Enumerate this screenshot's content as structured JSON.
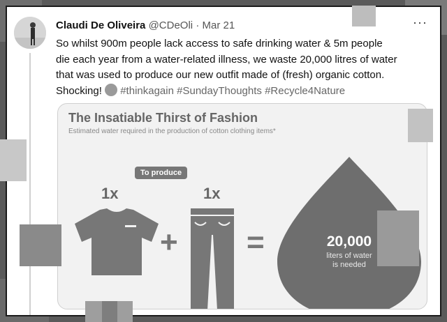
{
  "tweet": {
    "author_name": "Claudi De Oliveira",
    "author_handle": "@CDeOli",
    "separator": "·",
    "date": "Mar 21",
    "more_label": "···",
    "text_line1": "So whilst 900m people lack access to safe drinking water & 5m people",
    "text_line2": "die each year from a water-related illness, we waste 20,000 litres of water",
    "text_line3": "that was used to produce our new outfit made of (fresh) organic cotton.",
    "text_line4_start": "Shocking!",
    "hashtags": [
      "#thinkagain",
      "#SundayThoughts",
      "#Recycle4Nature"
    ]
  },
  "infographic": {
    "title": "The Insatiable Thirst of Fashion",
    "subtitle": "Estimated water required in the production of cotton clothing items*",
    "pill_label": "To produce",
    "shirt_qty": "1x",
    "jeans_qty": "1x",
    "plus": "+",
    "equals": "=",
    "water_value": "20,000",
    "water_caption_line1": "liters of water",
    "water_caption_line2": "is needed"
  },
  "icons": [
    "avatar-photo",
    "screaming-face-emoji",
    "tshirt-icon",
    "jeans-icon",
    "water-drop-icon"
  ]
}
